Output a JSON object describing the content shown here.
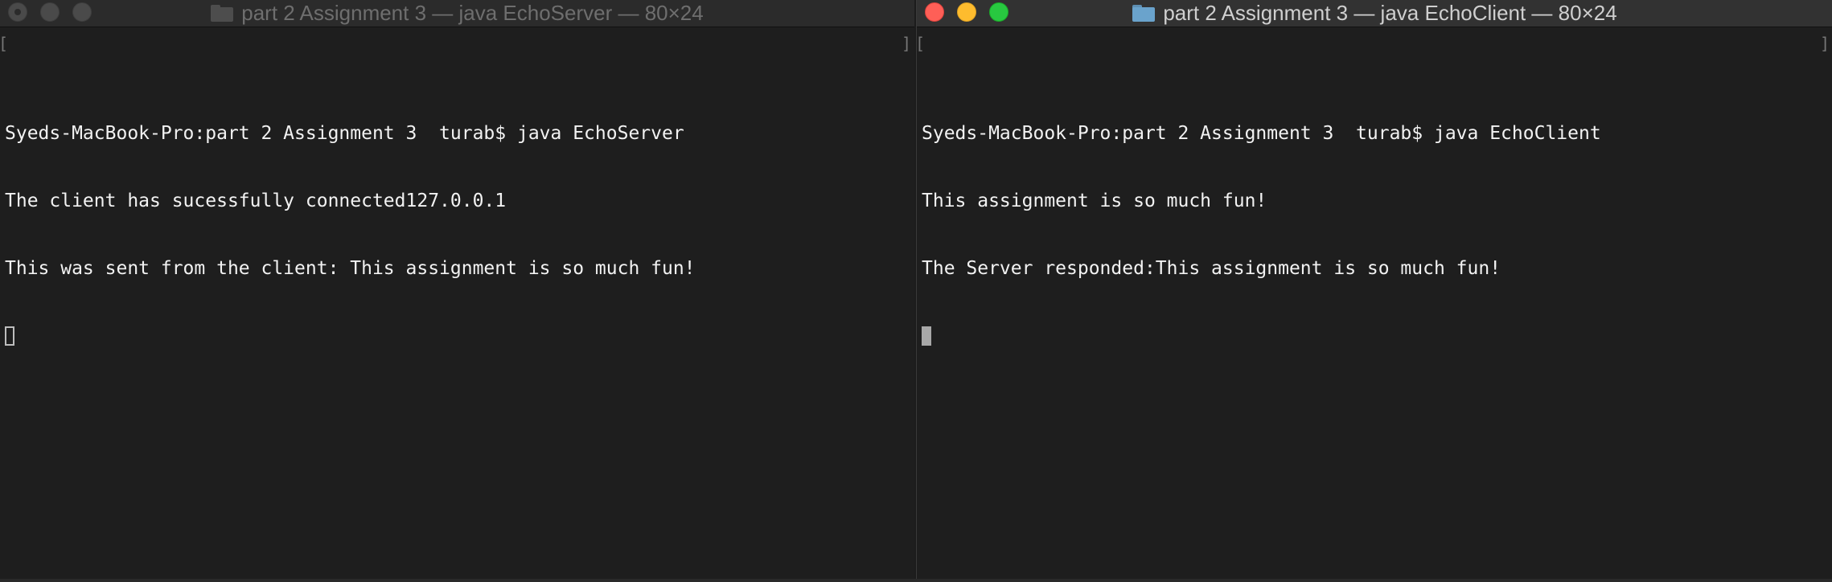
{
  "windows": {
    "server": {
      "title": "part 2 Assignment 3  — java EchoServer — 80×24",
      "bracket_left": "[",
      "bracket_right": "]",
      "lines": [
        "Syeds-MacBook-Pro:part 2 Assignment 3  turab$ java EchoServer",
        "The client has sucessfully connected127.0.0.1",
        "This was sent from the client: This assignment is so much fun!"
      ]
    },
    "client": {
      "title": "part 2 Assignment 3  — java EchoClient — 80×24",
      "bracket_left": "[",
      "bracket_right": "]",
      "lines": [
        "Syeds-MacBook-Pro:part 2 Assignment 3  turab$ java EchoClient",
        "This assignment is so much fun!",
        "The Server responded:This assignment is so much fun!"
      ]
    }
  },
  "colors": {
    "close": "#fe5f57",
    "minimize": "#febc2e",
    "zoom": "#28c840",
    "folder": "#6aa3cc",
    "terminal_bg": "#1e1e1e",
    "terminal_fg": "#f2f2f2"
  },
  "icons": {
    "folder": "folder-icon",
    "close": "close-button",
    "minimize": "minimize-button",
    "zoom": "zoom-button"
  }
}
